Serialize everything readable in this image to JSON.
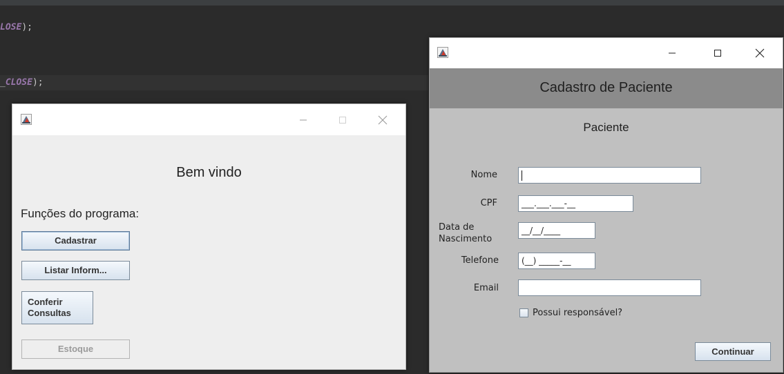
{
  "ide": {
    "line_a_kw": "LOSE",
    "line_a_rest": ");",
    "line_b_prefix": "_",
    "line_b_kw": "CLOSE",
    "line_b_rest": ");"
  },
  "welcome_window": {
    "greeting": "Bem vindo",
    "functions_label": "Funções do programa:",
    "buttons": {
      "cadastrar": "Cadastrar",
      "listar": "Listar Inform...",
      "conferir_line1": "Conferir",
      "conferir_line2": "Consultas",
      "estoque": "Estoque"
    }
  },
  "patient_window": {
    "title": "Cadastro de Paciente",
    "section": "Paciente",
    "labels": {
      "nome": "Nome",
      "cpf": "CPF",
      "data_line1": "Data de",
      "data_line2": "Nascimento",
      "telefone": "Telefone",
      "email": "Email"
    },
    "fields": {
      "nome": "",
      "cpf": "___.___.___-__",
      "data": "__/__/____",
      "telefone": "(__) _____-__",
      "email": ""
    },
    "checkbox_label": "Possui responsável?",
    "continue_button": "Continuar"
  },
  "title_controls": {
    "minimize": "—",
    "maximize": "☐",
    "close": "✕"
  }
}
